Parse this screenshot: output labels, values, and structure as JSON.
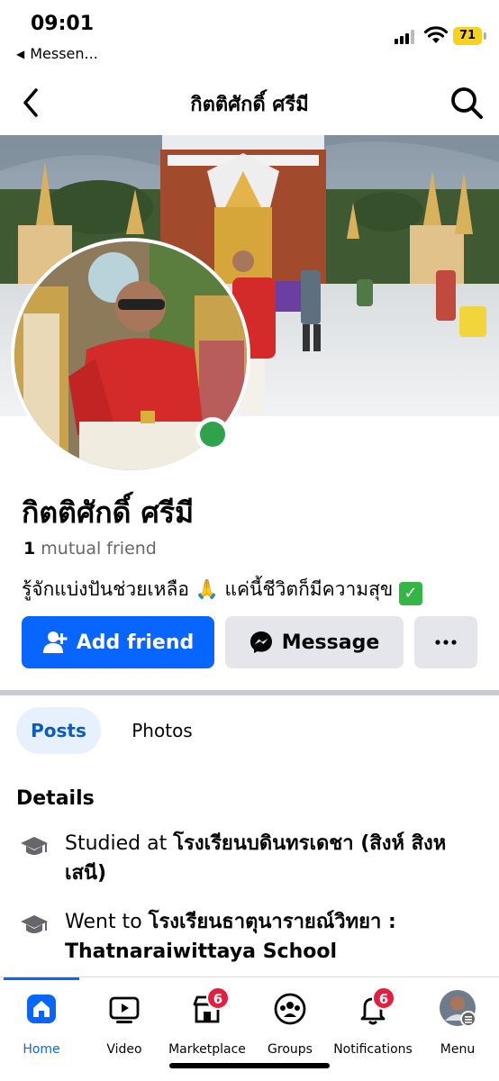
{
  "status": {
    "time": "09:01",
    "back_app": "Messen...",
    "battery": "71"
  },
  "nav": {
    "title": "กิตติศักดิ์ ศรีมี"
  },
  "profile": {
    "name": "กิตติศักดิ์ ศรีมี",
    "mutual_count": "1",
    "mutual_label": "mutual friend",
    "bio": "รู้จักแบ่งปันช่วยเหลือ 🙏 แค่นี้ชีวิตก็มีความสุข",
    "online": true
  },
  "actions": {
    "add_friend": "Add friend",
    "message": "Message"
  },
  "tabs": [
    {
      "label": "Posts",
      "active": true
    },
    {
      "label": "Photos",
      "active": false
    }
  ],
  "details": {
    "title": "Details",
    "items": [
      {
        "prefix": "Studied at",
        "value": "โรงเรียนบดินทรเดชา (สิงห์ สิงหเสนี)"
      },
      {
        "prefix": "Went to",
        "value": "โรงเรียนธาตุนารายณ์วิทยา : Thatnaraiwittaya School"
      }
    ]
  },
  "tabbar": [
    {
      "label": "Home",
      "icon": "home-icon",
      "active": true
    },
    {
      "label": "Video",
      "icon": "video-icon",
      "active": false
    },
    {
      "label": "Marketplace",
      "icon": "marketplace-icon",
      "badge": "6"
    },
    {
      "label": "Groups",
      "icon": "groups-icon"
    },
    {
      "label": "Notifications",
      "icon": "bell-icon",
      "badge": "6"
    },
    {
      "label": "Menu",
      "icon": "menu-avatar-icon"
    }
  ],
  "colors": {
    "accent": "#0866ff",
    "badge": "#e41e3f",
    "online": "#31a24c"
  }
}
